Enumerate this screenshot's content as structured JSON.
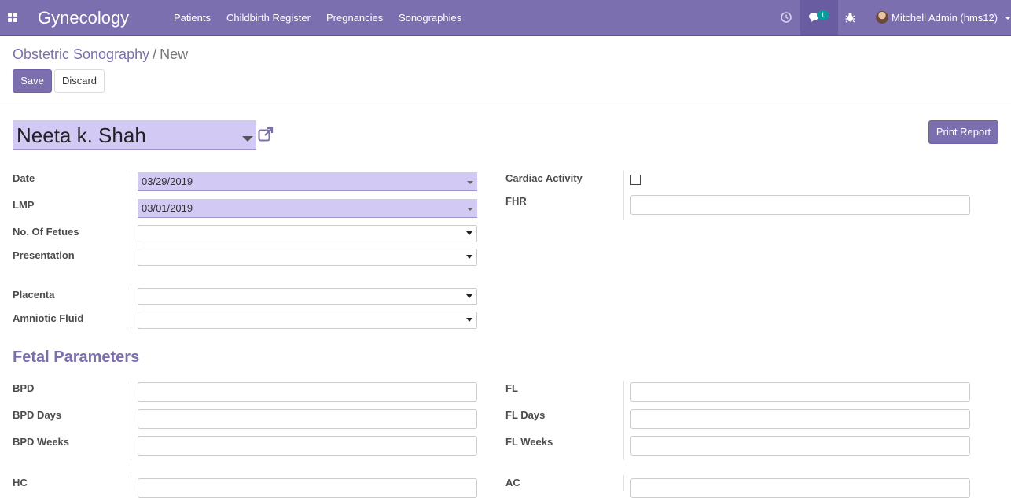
{
  "navbar": {
    "brand": "Gynecology",
    "menu": [
      "Patients",
      "Childbirth Register",
      "Pregnancies",
      "Sonographies"
    ],
    "messages_badge": "1",
    "user": "Mitchell Admin (hms12)",
    "icons": {
      "apps": "apps-grid-icon",
      "activity": "clock-icon",
      "messages": "chat-icon",
      "debug": "bug-icon"
    }
  },
  "breadcrumb": {
    "parent": "Obstetric Sonography",
    "separator": "/",
    "current": "New"
  },
  "buttons": {
    "save": "Save",
    "discard": "Discard",
    "print_report": "Print Report"
  },
  "form": {
    "patient": "Neeta k. Shah",
    "left": {
      "date_label": "Date",
      "date_value": "03/29/2019",
      "lmp_label": "LMP",
      "lmp_value": "03/01/2019",
      "fetuses_label": "No. Of Fetues",
      "fetuses_value": "",
      "presentation_label": "Presentation",
      "presentation_value": "",
      "placenta_label": "Placenta",
      "placenta_value": "",
      "amniotic_label": "Amniotic Fluid",
      "amniotic_value": ""
    },
    "right": {
      "cardiac_label": "Cardiac Activity",
      "cardiac_checked": false,
      "fhr_label": "FHR",
      "fhr_value": ""
    },
    "fetal_section_title": "Fetal Parameters",
    "fetal_left": [
      {
        "label": "BPD",
        "value": ""
      },
      {
        "label": "BPD Days",
        "value": ""
      },
      {
        "label": "BPD Weeks",
        "value": ""
      },
      {
        "label": "HC",
        "value": ""
      }
    ],
    "fetal_right": [
      {
        "label": "FL",
        "value": ""
      },
      {
        "label": "FL Days",
        "value": ""
      },
      {
        "label": "FL Weeks",
        "value": ""
      },
      {
        "label": "AC",
        "value": ""
      }
    ]
  },
  "colors": {
    "brand": "#7c6fb0",
    "required_field": "#d2c9f5",
    "badge": "#00a09d"
  }
}
